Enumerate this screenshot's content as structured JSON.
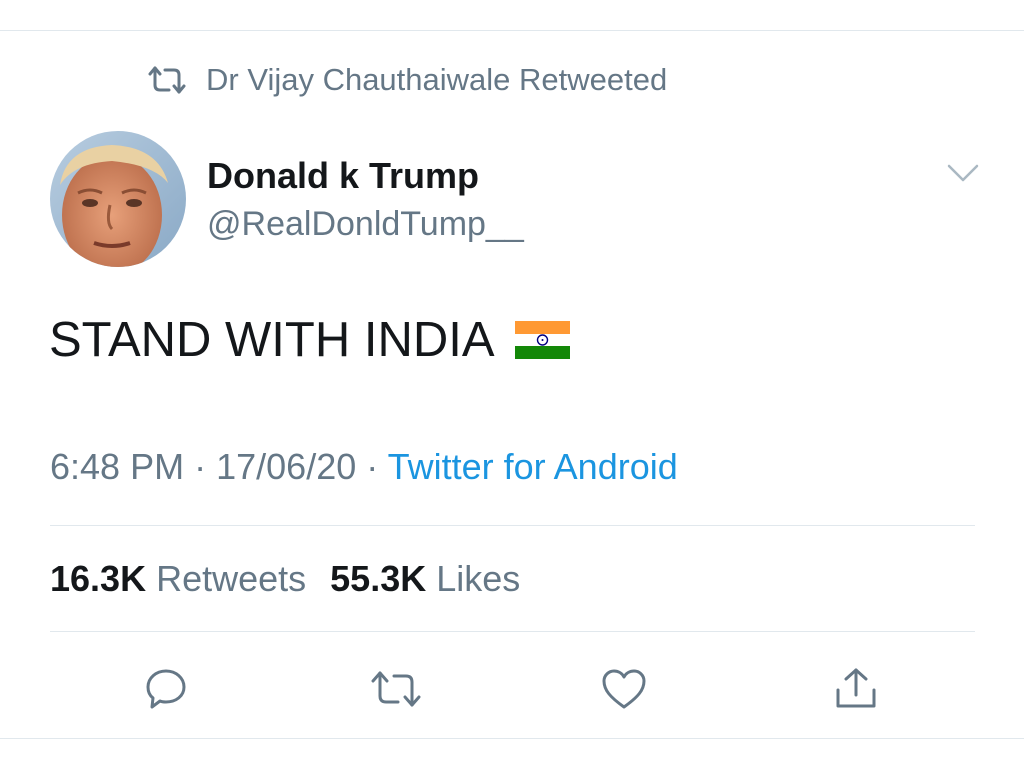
{
  "retweet_context": {
    "icon": "retweet-icon",
    "text": "Dr Vijay Chauthaiwale Retweeted"
  },
  "author": {
    "display_name": "Donald k Trump",
    "handle": "@RealDonldTump__",
    "avatar": "avatar"
  },
  "tweet": {
    "text": "STAND WITH INDIA",
    "emoji": "flag-india"
  },
  "meta": {
    "time": "6:48 PM",
    "separator": "·",
    "date": "17/06/20",
    "source": "Twitter for Android"
  },
  "stats": {
    "retweets_count": "16.3K",
    "retweets_label": "Retweets",
    "likes_count": "55.3K",
    "likes_label": "Likes"
  },
  "actions": [
    "reply-icon",
    "retweet-icon",
    "like-icon",
    "share-icon"
  ],
  "colors": {
    "text": "#14171a",
    "secondary": "#657786",
    "link": "#1b95e0",
    "divider": "#e1e8ed",
    "saffron": "#ff9933",
    "green": "#138808",
    "chakra": "#000080"
  }
}
